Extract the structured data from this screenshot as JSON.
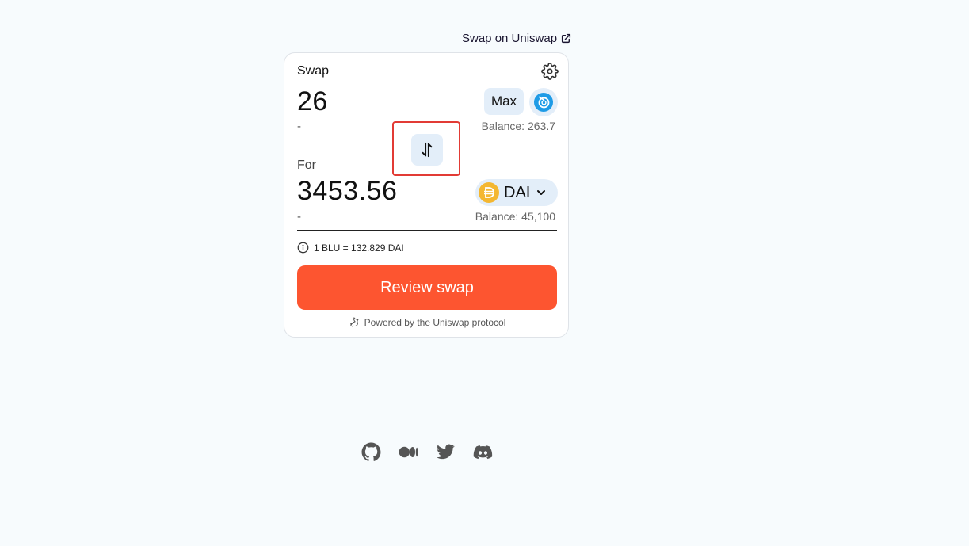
{
  "header": {
    "uniswap_link": "Swap on Uniswap"
  },
  "swap": {
    "title": "Swap",
    "input": {
      "amount": "26",
      "usd": "-",
      "max_label": "Max",
      "balance": "Balance: 263.7",
      "token_icon": "blu-token-icon"
    },
    "output": {
      "label": "For",
      "amount": "3453.56",
      "usd": "-",
      "token": "DAI",
      "balance": "Balance: 45,100"
    },
    "rate": "1 BLU = 132.829 DAI",
    "review_label": "Review swap",
    "powered_by": "Powered by the Uniswap protocol"
  },
  "footer": {
    "icons": [
      "github-icon",
      "medium-icon",
      "twitter-icon",
      "discord-icon"
    ]
  },
  "colors": {
    "accent": "#fd5530",
    "pill": "#e3eef9",
    "highlight": "#e23b35",
    "dai": "#f4b731"
  }
}
